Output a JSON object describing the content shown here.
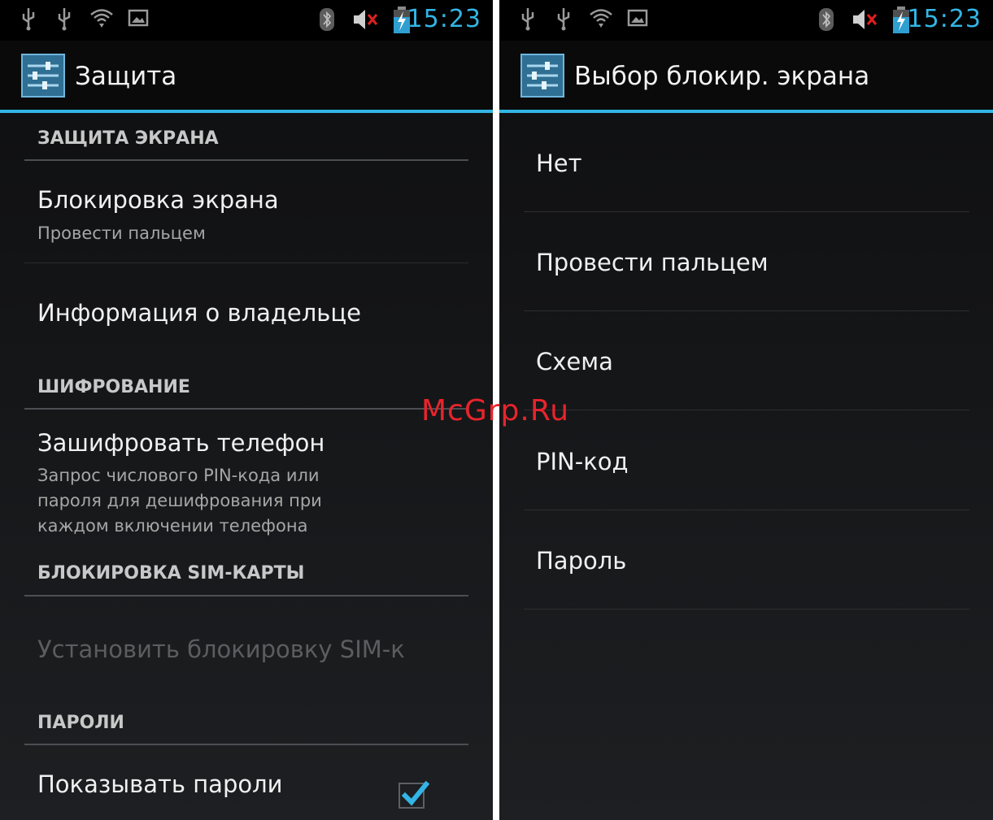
{
  "status_bar": {
    "time": "15:23",
    "accent_color": "#33b5e5"
  },
  "left_screen": {
    "title": "Защита",
    "sections": {
      "screen_security": {
        "header": "ЗАЩИТА ЭКРАНА",
        "screen_lock": {
          "title": "Блокировка экрана",
          "summary": "Провести пальцем"
        },
        "owner_info": {
          "title": "Информация о владельце"
        }
      },
      "encryption": {
        "header": "ШИФРОВАНИЕ",
        "encrypt_phone": {
          "title": "Зашифровать телефон",
          "summary": "Запрос числового PIN-кода или пароля для дешифрования при каждом включении телефона"
        }
      },
      "sim_lock": {
        "header": "БЛОКИРОВКА SIM-КАРТЫ",
        "set_sim_lock": {
          "title": "Установить блокировку SIM-к",
          "enabled": false
        }
      },
      "passwords": {
        "header": "ПАРОЛИ",
        "show_passwords": {
          "title": "Показывать пароли",
          "checked": true
        }
      }
    }
  },
  "right_screen": {
    "title": "Выбор блокир. экрана",
    "options": [
      "Нет",
      "Провести пальцем",
      "Схема",
      "PIN-код",
      "Пароль"
    ]
  },
  "watermark": "McGrp.Ru",
  "icons": {
    "status_left": [
      "usb-icon",
      "usb-icon",
      "wifi-icon",
      "gallery-icon"
    ],
    "status_right": [
      "bluetooth-icon",
      "mute-icon",
      "battery-charging-icon"
    ],
    "app": "settings-icon",
    "check": "checkmark-icon"
  }
}
